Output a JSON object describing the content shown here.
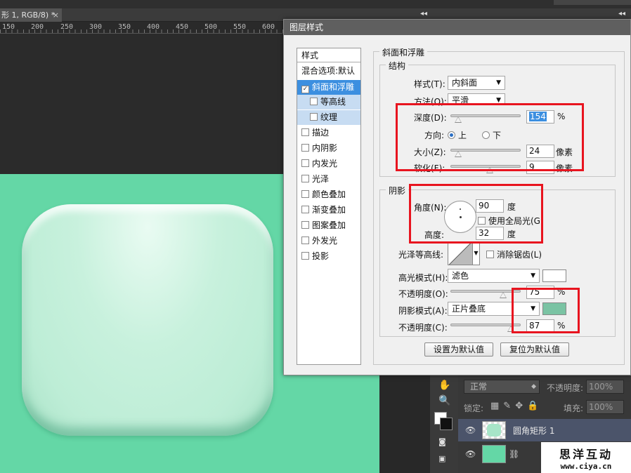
{
  "app": {
    "doc_tab": "形 1, RGB/8) *",
    "tab_close": "×",
    "ruler_ticks": [
      "150",
      "200",
      "250",
      "300",
      "350",
      "400",
      "450",
      "500",
      "550",
      "600"
    ],
    "panel_collapse": "◂◂"
  },
  "dialog": {
    "title": "图层样式",
    "nav": {
      "header": "样式",
      "blend": "混合选项:默认",
      "items": [
        {
          "label": "斜面和浮雕",
          "checked": true,
          "active": true
        },
        {
          "label": "等高线",
          "checked": false,
          "sub": true
        },
        {
          "label": "纹理",
          "checked": false,
          "sub": true
        },
        {
          "label": "描边",
          "checked": false
        },
        {
          "label": "内阴影",
          "checked": false
        },
        {
          "label": "内发光",
          "checked": false
        },
        {
          "label": "光泽",
          "checked": false
        },
        {
          "label": "颜色叠加",
          "checked": false
        },
        {
          "label": "渐变叠加",
          "checked": false
        },
        {
          "label": "图案叠加",
          "checked": false
        },
        {
          "label": "外发光",
          "checked": false
        },
        {
          "label": "投影",
          "checked": false
        }
      ],
      "check_mark": "✓"
    },
    "bevel": {
      "legend": "斜面和浮雕",
      "structure": {
        "legend": "结构",
        "style_label": "样式(T):",
        "style_value": "内斜面",
        "method_label": "方法(Q):",
        "method_value": "平滑",
        "depth_label": "深度(D):",
        "depth_value": "154",
        "depth_unit": "%",
        "depth_level": 0.1,
        "direction_label": "方向:",
        "dir_up": "上",
        "dir_down": "下",
        "size_label": "大小(Z):",
        "size_value": "24",
        "size_unit": "像素",
        "size_level": 0.1,
        "soften_label": "软化(F):",
        "soften_value": "9",
        "soften_unit": "像素",
        "soften_level": 0.56
      },
      "shading": {
        "legend": "阴影",
        "angle_label": "角度(N):",
        "angle_value": "90",
        "angle_unit": "度",
        "global_light_label": "使用全局光(G)",
        "altitude_label": "高度:",
        "altitude_value": "32",
        "altitude_unit": "度",
        "gloss_label": "光泽等高线:",
        "antialias_label": "消除锯齿(L)",
        "highlight_mode_label": "高光模式(H):",
        "highlight_mode_value": "滤色",
        "highlight_color": "#ffffff",
        "hl_opacity_label": "不透明度(O):",
        "hl_opacity_value": "75",
        "hl_opacity_unit": "%",
        "hl_opacity_level": 0.75,
        "shadow_mode_label": "阴影模式(A):",
        "shadow_mode_value": "正片叠底",
        "shadow_color": "#7ac3a3",
        "sh_opacity_label": "不透明度(C):",
        "sh_opacity_value": "87",
        "sh_opacity_unit": "%",
        "sh_opacity_level": 0.87
      },
      "btn_set_default": "设置为默认值",
      "btn_reset_default": "复位为默认值"
    }
  },
  "layers": {
    "blend_mode": "正常",
    "opacity_label": "不透明度:",
    "opacity_value": "100%",
    "lock_label": "锁定:",
    "fill_label": "填充:",
    "fill_value": "100%",
    "layer1_name": "圆角矩形 1"
  },
  "watermark": {
    "title": "思洋互动",
    "url": "www.ciya.cn"
  },
  "colors": {
    "canvas_green": "#64d7a6",
    "accent_red": "#e8141f",
    "nav_active": "#3c8fe0"
  }
}
